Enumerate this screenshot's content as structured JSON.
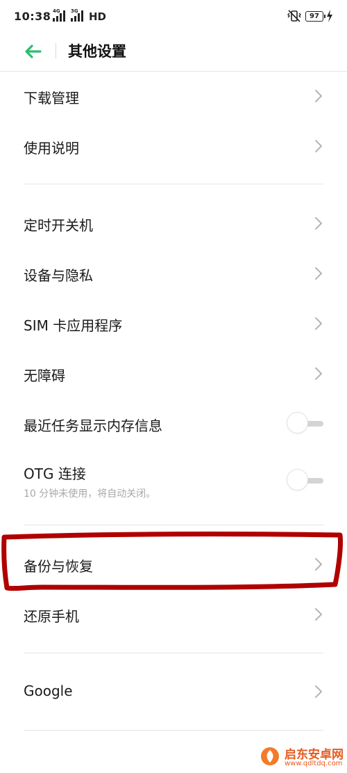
{
  "status_bar": {
    "time": "10:38",
    "signal1_label": "4G",
    "signal2_label": "3G",
    "network": "HD",
    "battery": "97",
    "icons": [
      "vibrate-icon",
      "battery-icon",
      "charging-icon"
    ]
  },
  "header": {
    "title": "其他设置",
    "back_icon": "back-arrow-icon",
    "accent_color": "#2bbd6e"
  },
  "groups": [
    {
      "items": [
        {
          "label": "下载管理",
          "control": "chevron"
        },
        {
          "label": "使用说明",
          "control": "chevron"
        }
      ]
    },
    {
      "items": [
        {
          "label": "定时开关机",
          "control": "chevron"
        },
        {
          "label": "设备与隐私",
          "control": "chevron"
        },
        {
          "label": "SIM 卡应用程序",
          "control": "chevron"
        },
        {
          "label": "无障碍",
          "control": "chevron"
        },
        {
          "label": "最近任务显示内存信息",
          "control": "toggle",
          "checked": false
        },
        {
          "label": "OTG 连接",
          "sublabel": "10 分钟未使用，将自动关闭。",
          "control": "toggle",
          "checked": false
        }
      ]
    },
    {
      "items": [
        {
          "label": "备份与恢复",
          "control": "chevron",
          "highlighted": true
        },
        {
          "label": "还原手机",
          "control": "chevron"
        }
      ]
    },
    {
      "items": [
        {
          "label": "Google",
          "control": "chevron"
        }
      ]
    }
  ],
  "annotation_color": "#b00000",
  "watermark": {
    "name": "启东安卓网",
    "url": "www.qdltdq.com"
  }
}
